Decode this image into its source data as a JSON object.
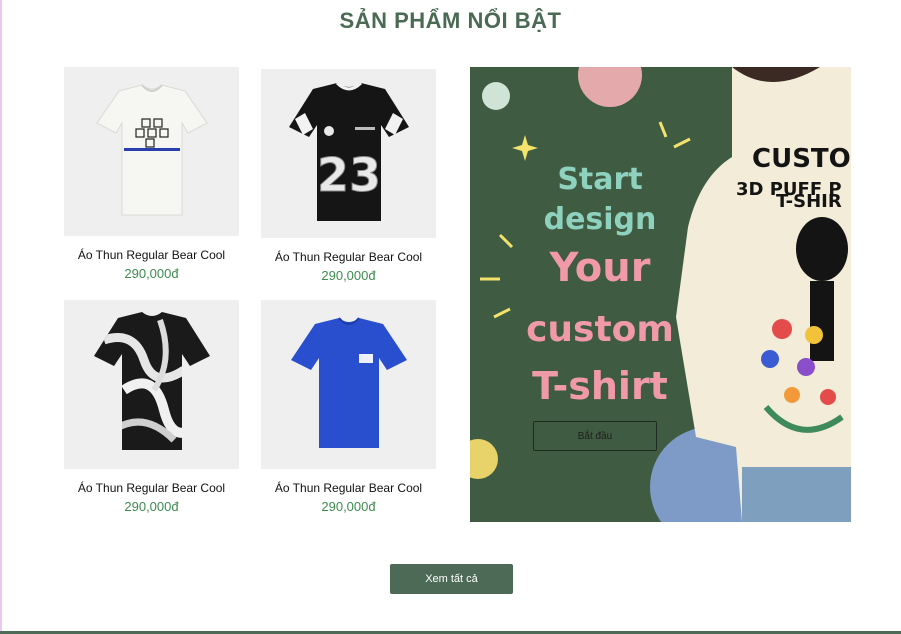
{
  "section": {
    "title": "SẢN PHẨM NỔI BẬT"
  },
  "products": [
    {
      "name": "Áo Thun Regular Bear Cool",
      "price": "290,000đ",
      "image_icon": "white-tshirt-icon"
    },
    {
      "name": "Áo Thun Regular Bear Cool",
      "price": "290,000đ",
      "image_icon": "black-jersey-23-icon"
    },
    {
      "name": "Áo Thun Regular Bear Cool",
      "price": "290,000đ",
      "image_icon": "black-white-pattern-tshirt-icon"
    },
    {
      "name": "Áo Thun Regular Bear Cool",
      "price": "290,000đ",
      "image_icon": "blue-tshirt-icon"
    }
  ],
  "banner": {
    "line1": "Start",
    "line2": "design",
    "line3": "Your",
    "line4": "custom",
    "line5": "T-shirt",
    "shirt_print_line1": "CUSTO",
    "shirt_print_line2": "3D PUFF P",
    "shirt_print_line3": "T-SHIR",
    "button_label": "Bắt đầu"
  },
  "view_all_label": "Xem tất cả",
  "colors": {
    "accent": "#4b6a54",
    "price": "#3d8b4f",
    "banner_bg": "#3f5b41",
    "banner_text_teal": "#8fd1bf",
    "banner_text_pink": "#f09aa9"
  }
}
